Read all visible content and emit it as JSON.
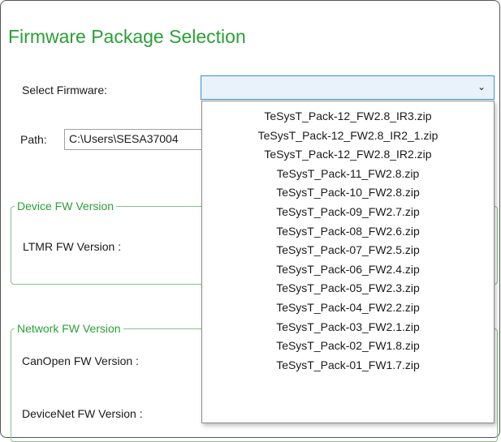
{
  "title": "Firmware Package Selection",
  "select_firmware": {
    "label": "Select Firmware:",
    "value": "",
    "options": [
      "TeSysT_Pack-12_FW2.8_IR3.zip",
      "TeSysT_Pack-12_FW2.8_IR2_1.zip",
      "TeSysT_Pack-12_FW2.8_IR2.zip",
      "TeSysT_Pack-11_FW2.8.zip",
      "TeSysT_Pack-10_FW2.8.zip",
      "TeSysT_Pack-09_FW2.7.zip",
      "TeSysT_Pack-08_FW2.6.zip",
      "TeSysT_Pack-07_FW2.5.zip",
      "TeSysT_Pack-06_FW2.4.zip",
      "TeSysT_Pack-05_FW2.3.zip",
      "TeSysT_Pack-04_FW2.2.zip",
      "TeSysT_Pack-03_FW2.1.zip",
      "TeSysT_Pack-02_FW1.8.zip",
      "TeSysT_Pack-01_FW1.7.zip"
    ]
  },
  "path": {
    "label": "Path:",
    "value": "C:\\Users\\SESA37004"
  },
  "device_fw": {
    "group_title": "Device FW Version",
    "ltmr_label": "LTMR FW Version :"
  },
  "network_fw": {
    "group_title": "Network FW Version",
    "canopen_label": "CanOpen FW Version :",
    "devicenet_label": "DeviceNet FW Version :"
  },
  "icons": {
    "dropdown_chevron": "chevron-down-icon"
  }
}
